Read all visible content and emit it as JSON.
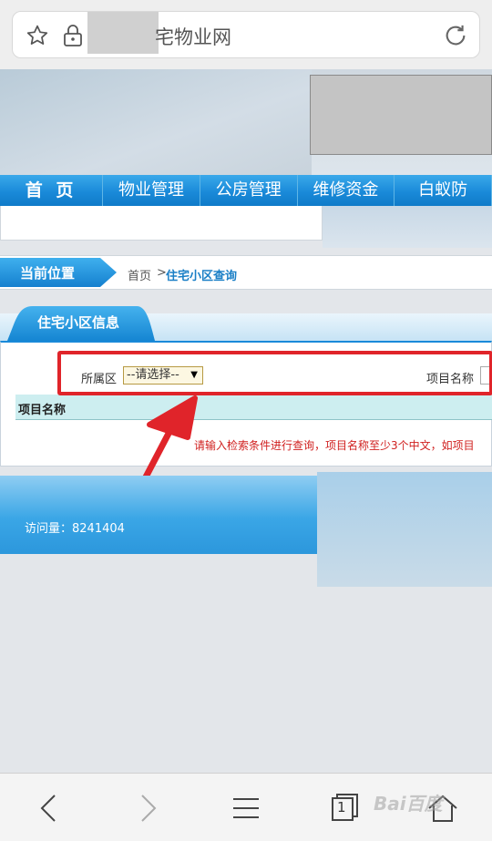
{
  "browser": {
    "url_text": "宅物业网"
  },
  "nav": {
    "items": [
      "首 页",
      "物业管理",
      "公房管理",
      "维修资金",
      "白蚁防"
    ]
  },
  "breadcrumb": {
    "label": "当前位置",
    "home": "首页",
    "separator": ">",
    "current": "住宅小区查询"
  },
  "panel": {
    "tab_title": "住宅小区信息",
    "district_label": "所属区",
    "district_selected": "--请选择--",
    "project_name_label": "项目名称",
    "table_column": "项目名称",
    "hint": "请输入检索条件进行查询，项目名称至少3个中文，如项目"
  },
  "footer": {
    "visit_count": "访问量：8241404"
  },
  "toolbar": {
    "tab_count": "1"
  },
  "watermark": {
    "text": "Bai百度"
  },
  "colors": {
    "nav_blue": "#1a8ad9",
    "annotation_red": "#e0242a",
    "hint_red": "#d0201f",
    "table_header_bg": "#cdeef0"
  }
}
